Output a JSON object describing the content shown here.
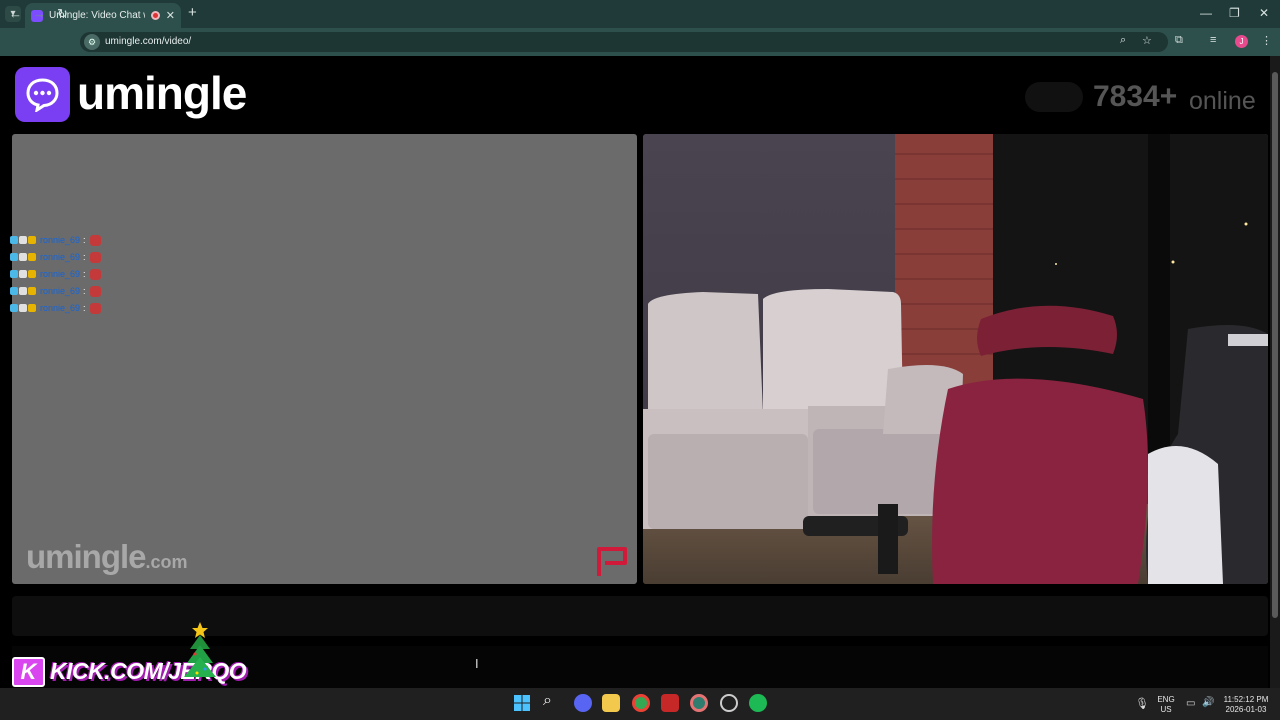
{
  "browser": {
    "tab_title": "Umingle: Video Chat with S",
    "tab_close": "✕",
    "new_tab": "+",
    "url": "umingle.com/video/",
    "window": {
      "minimize": "—",
      "restore": "❐",
      "close": "✕"
    },
    "profile_initial": "J"
  },
  "site": {
    "logo_text": "umingle",
    "online_count": "7834+",
    "online_label": "online",
    "watermark_main": "umingle",
    "watermark_suffix": ".com"
  },
  "chat_overlay": {
    "messages": [
      {
        "user": "ronnie_69",
        "separator": ":"
      },
      {
        "user": "ronnie_69",
        "separator": ":"
      },
      {
        "user": "ronnie_69",
        "separator": ":"
      },
      {
        "user": "ronnie_69",
        "separator": ":"
      },
      {
        "user": "ronnie_69",
        "separator": ":"
      }
    ]
  },
  "stream_banner": {
    "logo_letter": "K",
    "text": "KICK.COM/JERQO"
  },
  "taskbar": {
    "lang_top": "ENG",
    "lang_bottom": "US",
    "time": "11:52:12 PM",
    "date": "2026-01-03"
  },
  "colors": {
    "brand_purple": "#7a3ff2",
    "chrome_bg": "#2e504c",
    "kick_magenta": "#d946ef"
  }
}
